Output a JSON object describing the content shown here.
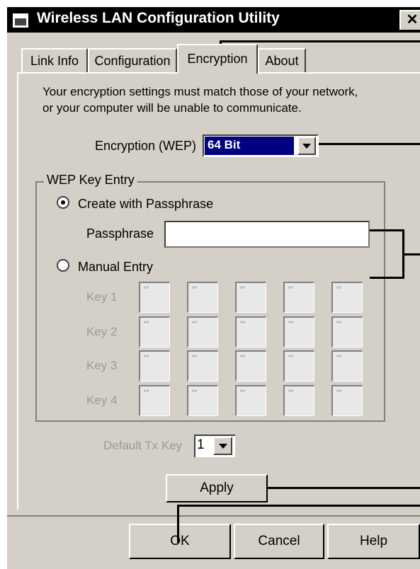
{
  "window": {
    "title": "Wireless LAN Configuration Utility",
    "close_glyph": "✕"
  },
  "tabs": [
    {
      "label": "Link Info",
      "active": false
    },
    {
      "label": "Configuration",
      "active": false
    },
    {
      "label": "Encryption",
      "active": true
    },
    {
      "label": "About",
      "active": false
    }
  ],
  "encryption": {
    "info_line1": "Your encryption settings must match those of your network,",
    "info_line2": "or your computer will be unable to communicate.",
    "wep_label": "Encryption (WEP)",
    "wep_value": "64 Bit"
  },
  "wep_key_entry": {
    "group_title": "WEP Key Entry",
    "create_option": "Create with Passphrase",
    "create_selected": true,
    "passphrase_label": "Passphrase",
    "passphrase_value": "",
    "manual_option": "Manual Entry",
    "manual_selected": false,
    "keys": [
      {
        "label": "Key 1",
        "bytes": [
          "**",
          "**",
          "**",
          "**",
          "**"
        ]
      },
      {
        "label": "Key 2",
        "bytes": [
          "**",
          "**",
          "**",
          "**",
          "**"
        ]
      },
      {
        "label": "Key 3",
        "bytes": [
          "**",
          "**",
          "**",
          "**",
          "**"
        ]
      },
      {
        "label": "Key 4",
        "bytes": [
          "**",
          "**",
          "**",
          "**",
          "**"
        ]
      }
    ]
  },
  "default_tx": {
    "label": "Default Tx Key",
    "value": "1"
  },
  "buttons": {
    "apply": "Apply",
    "ok": "OK",
    "cancel": "Cancel",
    "help": "Help"
  }
}
